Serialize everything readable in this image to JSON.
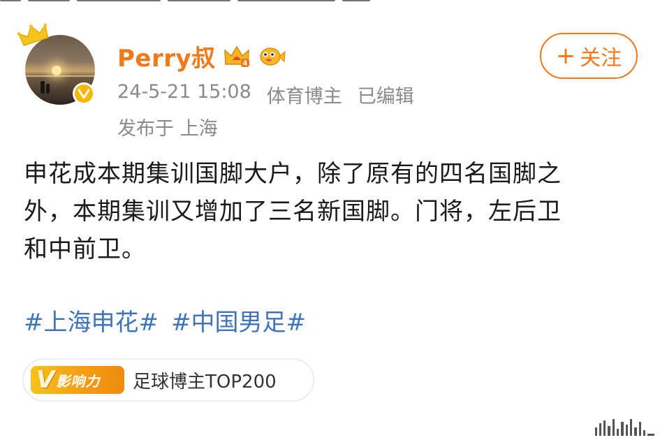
{
  "author": {
    "username": "Perry叔",
    "crown_icon": "crown-icon",
    "member_badge_icon": "vip-crown-badge-icon",
    "fish_badge_icon": "pufferfish-badge-icon",
    "verified_icon": "verified-v-icon"
  },
  "follow_button": {
    "plus": "+",
    "label": "关注"
  },
  "meta": {
    "timestamp": "24-5-21 15:08",
    "category": "体育博主",
    "edited": "已编辑",
    "location": "发布于 上海"
  },
  "post": {
    "lines": [
      "申花成本期集训国脚大户，除了原有的四名国脚之",
      "外，本期集训又增加了三名新国脚。门将，左后卫",
      "和中前卫。"
    ]
  },
  "hashtags": [
    "#上海申花#",
    "#中国男足#"
  ],
  "influence": {
    "badge_v": "V",
    "badge_text": "影响力",
    "label": "足球博主TOP200"
  },
  "colors": {
    "accent": "#f07a1a",
    "link": "#3f74b8",
    "meta": "#8a8a8a",
    "text": "#1a1a1a"
  }
}
